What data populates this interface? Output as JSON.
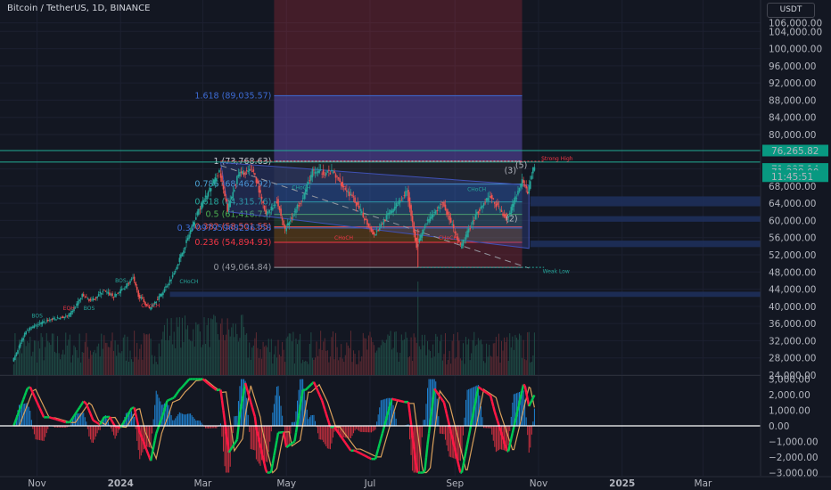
{
  "header": {
    "title": "Bitcoin / TetherUS, 1D, BINANCE",
    "currency": "USDT"
  },
  "chart_data": [
    {
      "type": "line",
      "title": "Bitcoin / TetherUS, 1D, BINANCE",
      "y_unit": "USDT",
      "ylim": [
        24000,
        108000
      ],
      "y_ticks": [
        {
          "label": "106,000.00",
          "value": 106000
        },
        {
          "label": "104,000.00",
          "value": 104000
        },
        {
          "label": "100,000.00",
          "value": 100000
        },
        {
          "label": "96,000.00",
          "value": 96000
        },
        {
          "label": "92,000.00",
          "value": 92000
        },
        {
          "label": "88,000.00",
          "value": 88000
        },
        {
          "label": "84,000.00",
          "value": 84000
        },
        {
          "label": "80,000.00",
          "value": 80000
        },
        {
          "label": "72,000.00",
          "value": 72000
        },
        {
          "label": "68,000.00",
          "value": 68000
        },
        {
          "label": "64,000.00",
          "value": 64000
        },
        {
          "label": "60,000.00",
          "value": 60000
        },
        {
          "label": "56,000.00",
          "value": 56000
        },
        {
          "label": "52,000.00",
          "value": 52000
        },
        {
          "label": "48,000.00",
          "value": 48000
        },
        {
          "label": "44,000.00",
          "value": 44000
        },
        {
          "label": "40,000.00",
          "value": 40000
        },
        {
          "label": "36,000.00",
          "value": 36000
        },
        {
          "label": "32,000.00",
          "value": 32000
        },
        {
          "label": "28,000.00",
          "value": 28000
        },
        {
          "label": "24,000.00",
          "value": 24000
        }
      ],
      "x_ticks": [
        {
          "label": "Nov",
          "date": "2023-11-01"
        },
        {
          "label": "2024",
          "date": "2024-01-01"
        },
        {
          "label": "Mar",
          "date": "2024-03-01"
        },
        {
          "label": "May",
          "date": "2024-05-01"
        },
        {
          "label": "Jul",
          "date": "2024-07-01"
        },
        {
          "label": "Sep",
          "date": "2024-09-01"
        },
        {
          "label": "Nov",
          "date": "2024-11-01"
        },
        {
          "label": "2025",
          "date": "2025-01-01"
        },
        {
          "label": "Mar",
          "date": "2025-03-01"
        }
      ],
      "price_series": {
        "name": "BTCUSDT close",
        "points": [
          [
            "2023-10-15",
            27000
          ],
          [
            "2023-10-25",
            34500
          ],
          [
            "2023-11-10",
            36800
          ],
          [
            "2023-11-25",
            37700
          ],
          [
            "2023-12-05",
            42500
          ],
          [
            "2023-12-12",
            41200
          ],
          [
            "2023-12-20",
            43700
          ],
          [
            "2023-12-28",
            42300
          ],
          [
            "2024-01-04",
            44200
          ],
          [
            "2024-01-11",
            46500
          ],
          [
            "2024-01-15",
            42600
          ],
          [
            "2024-01-23",
            39500
          ],
          [
            "2024-02-01",
            43000
          ],
          [
            "2024-02-09",
            47100
          ],
          [
            "2024-02-15",
            51800
          ],
          [
            "2024-02-28",
            62500
          ],
          [
            "2024-03-05",
            66000
          ],
          [
            "2024-03-14",
            71500
          ],
          [
            "2024-03-20",
            62500
          ],
          [
            "2024-03-28",
            70800
          ],
          [
            "2024-04-08",
            71600
          ],
          [
            "2024-04-17",
            61300
          ],
          [
            "2024-04-25",
            64500
          ],
          [
            "2024-05-01",
            57800
          ],
          [
            "2024-05-15",
            66200
          ],
          [
            "2024-05-21",
            71400
          ],
          [
            "2024-06-05",
            71100
          ],
          [
            "2024-06-20",
            64900
          ],
          [
            "2024-07-05",
            56600
          ],
          [
            "2024-07-14",
            60800
          ],
          [
            "2024-07-29",
            66800
          ],
          [
            "2024-08-05",
            53900
          ],
          [
            "2024-08-12",
            59400
          ],
          [
            "2024-08-24",
            64100
          ],
          [
            "2024-09-06",
            53900
          ],
          [
            "2024-09-18",
            61700
          ],
          [
            "2024-09-27",
            65800
          ],
          [
            "2024-10-10",
            60300
          ],
          [
            "2024-10-21",
            69000
          ],
          [
            "2024-10-25",
            66600
          ],
          [
            "2024-10-29",
            71997.14
          ]
        ]
      },
      "fib_levels": [
        {
          "label": "1.618 (89,035.57)",
          "ratio": 1.618,
          "value": 89035.57,
          "color": "#3d6bd4"
        },
        {
          "label": "1 (73,768.63)",
          "ratio": 1,
          "value": 73768.63,
          "color": "#c8cbd3"
        },
        {
          "label": "0.786 (68,462.92)",
          "ratio": 0.786,
          "value": 68462.92,
          "color": "#4aa3d4"
        },
        {
          "label": "0.618 (64,315.76)",
          "ratio": 0.618,
          "value": 64315.76,
          "color": "#26a69a"
        },
        {
          "label": "0.5 (61,416.73)",
          "ratio": 0.5,
          "value": 61416.73,
          "color": "#4caf50"
        },
        {
          "label": "0.382 (58,501.55)",
          "ratio": 0.382,
          "value": 58501.55,
          "color": "#ef5350"
        },
        {
          "label": "0.3709795968236358",
          "ratio": 0.3709795968236358,
          "value": 58250,
          "color": "#3d6bd4"
        },
        {
          "label": "0.236 (54,894.93)",
          "ratio": 0.236,
          "value": 54894.93,
          "color": "#f23645"
        },
        {
          "label": "0 (49,064.84)",
          "ratio": 0,
          "value": 49064.84,
          "color": "#9598a1"
        }
      ],
      "price_tags": [
        {
          "text": "76,265.82",
          "value": 76265.82,
          "color": "#089981"
        },
        {
          "text": "71,997.14",
          "value": 71997.14,
          "color": "#089981"
        },
        {
          "text": "71,239.00",
          "value": 71239.0,
          "color": "#089981"
        },
        {
          "text": "11:45:51",
          "value": 70300,
          "color": "#089981"
        }
      ],
      "zones": [
        {
          "from": 63300,
          "to": 65600,
          "color": "#1e2f5a",
          "start": "2024-10-26"
        },
        {
          "from": 59700,
          "to": 61000,
          "color": "#1e2f5a",
          "start": "2024-10-26"
        },
        {
          "from": 53800,
          "to": 55300,
          "color": "#1e2f5a",
          "start": "2024-10-26"
        },
        {
          "from": 42200,
          "to": 43400,
          "color": "#1e2f5a",
          "start": "2024-02-06"
        }
      ],
      "annotations": [
        {
          "text": "Strong High",
          "date": "2024-11-03",
          "value": 74000,
          "color": "#f23645"
        },
        {
          "text": "Weak Low",
          "date": "2024-11-04",
          "value": 47800,
          "color": "#26a69a"
        },
        {
          "text": "CHoCH",
          "date": "2024-06-05",
          "value": 55500,
          "color": "#f23645"
        },
        {
          "text": "CHoCH",
          "date": "2024-08-20",
          "value": 55500,
          "color": "#f23645"
        },
        {
          "text": "CHoCH",
          "date": "2024-05-05",
          "value": 67200,
          "color": "#26a69a"
        },
        {
          "text": "CHoCH",
          "date": "2024-09-10",
          "value": 66800,
          "color": "#26a69a"
        },
        {
          "text": "CHoCH",
          "date": "2024-01-16",
          "value": 39800,
          "color": "#f23645"
        },
        {
          "text": "CHoCH",
          "date": "2024-02-13",
          "value": 45400,
          "color": "#26a69a"
        },
        {
          "text": "EQH",
          "date": "2023-11-20",
          "value": 39100,
          "color": "#f23645"
        },
        {
          "text": "BOS",
          "date": "2023-12-05",
          "value": 39100,
          "color": "#26a69a"
        },
        {
          "text": "BOS",
          "date": "2023-10-28",
          "value": 37400,
          "color": "#26a69a"
        },
        {
          "text": "BOS",
          "date": "2023-12-28",
          "value": 45600,
          "color": "#26a69a"
        },
        {
          "text": "(3)",
          "date": "2024-10-07",
          "value": 71000,
          "color": "#b2b5be"
        },
        {
          "text": "(5)",
          "date": "2024-10-15",
          "value": 72200,
          "color": "#b2b5be"
        },
        {
          "text": "(2)",
          "date": "2024-10-08",
          "value": 59800,
          "color": "#b2b5be"
        }
      ],
      "oscillator": {
        "ylim": [
          -3200,
          3200
        ],
        "ticks": [
          {
            "label": "3,000.00",
            "value": 3000
          },
          {
            "label": "2,000.00",
            "value": 2000
          },
          {
            "label": "1,000.00",
            "value": 1000
          },
          {
            "label": "0.00",
            "value": 0
          },
          {
            "label": "−1,000.00",
            "value": -1000
          },
          {
            "label": "−2,000.00",
            "value": -2000
          },
          {
            "label": "−3,000.00",
            "value": -3000
          }
        ]
      }
    }
  ]
}
